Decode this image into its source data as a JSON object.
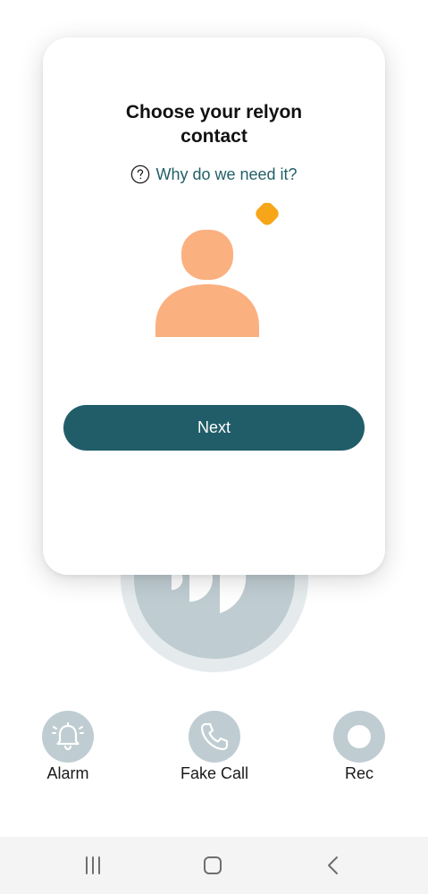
{
  "card": {
    "title": "Choose your relyon contact",
    "help_link": "Why do we need it?",
    "next_label": "Next"
  },
  "actions": [
    {
      "label": "Alarm",
      "icon": "bell-icon"
    },
    {
      "label": "Fake Call",
      "icon": "phone-icon"
    },
    {
      "label": "Rec",
      "icon": "record-icon"
    }
  ],
  "nav": {
    "recents_icon": "recents-icon",
    "home_icon": "home-icon",
    "back_icon": "back-icon"
  },
  "colors": {
    "primary": "#205d68",
    "link": "#235f67",
    "avatar": "#fbb080",
    "badge": "#f6a618",
    "circle": "#bfcdd2",
    "circle_halo": "#e5ebed"
  }
}
